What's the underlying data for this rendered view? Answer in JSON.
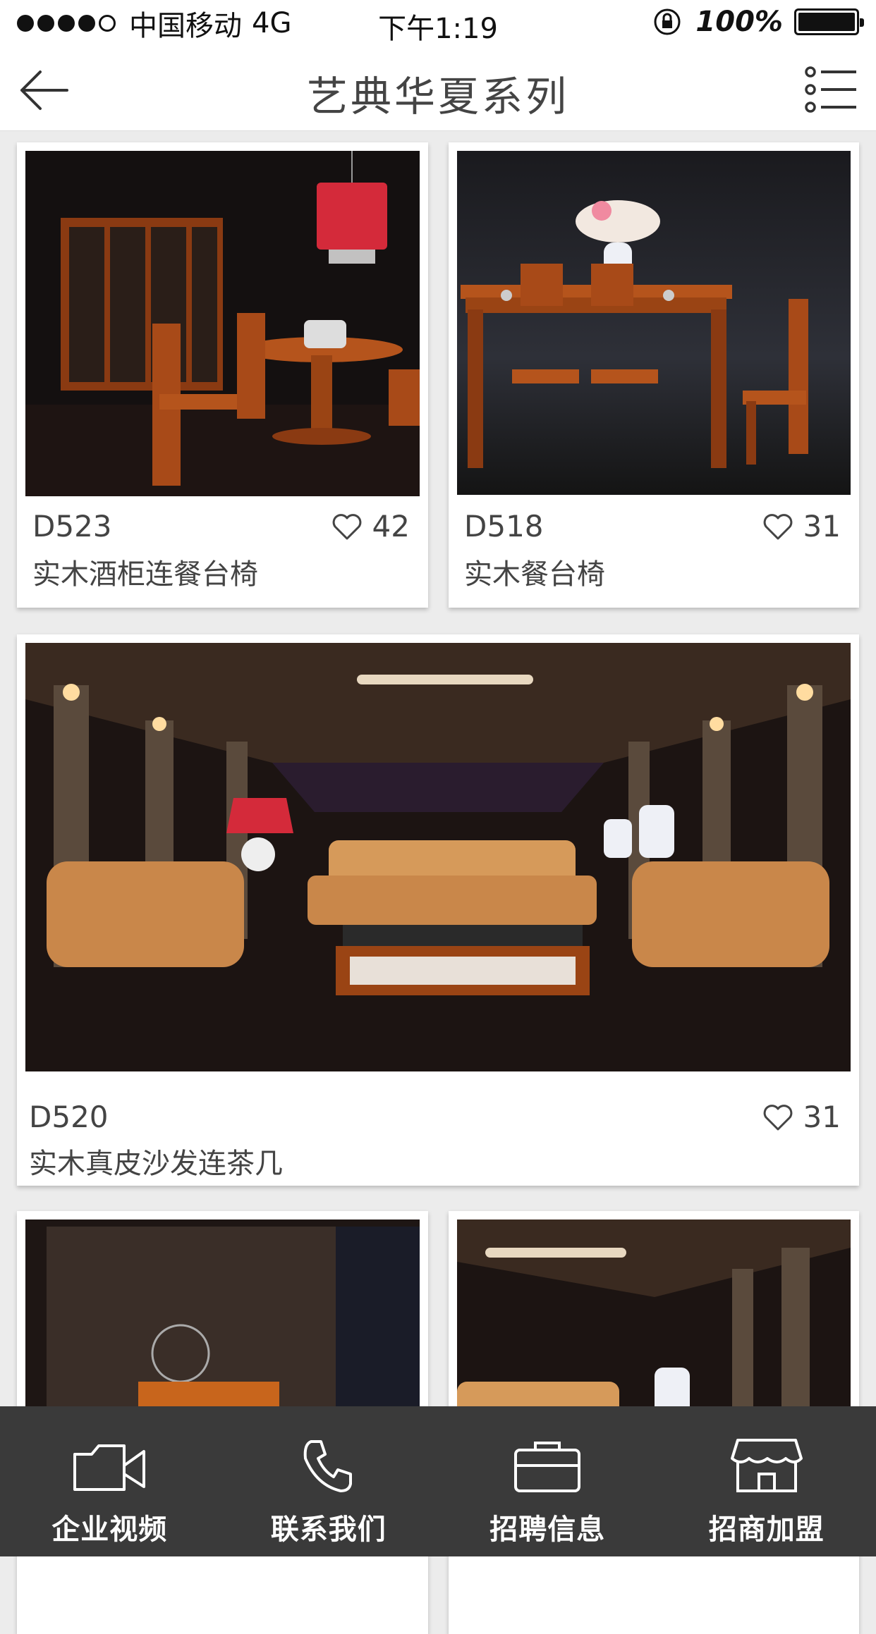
{
  "status_bar": {
    "carrier": "中国移动",
    "network": "4G",
    "time": "下午1:19",
    "battery_percent": "100%",
    "signal_bars_filled": 4,
    "signal_bars_total": 5
  },
  "header": {
    "title": "艺典华夏系列",
    "back_icon": "arrow-left-icon",
    "menu_icon": "list-menu-icon"
  },
  "products": [
    {
      "code": "D523",
      "name": "实木酒柜连餐台椅",
      "likes": "42",
      "image": "dining-room-wine-cabinet-round-table-photo"
    },
    {
      "code": "D518",
      "name": "实木餐台椅",
      "likes": "31",
      "image": "rectangular-dining-table-chairs-photo"
    },
    {
      "code": "D520",
      "name": "实木真皮沙发连茶几",
      "likes": "31",
      "image": "leather-sofa-set-with-tea-table-photo"
    },
    {
      "code": "",
      "name": "",
      "likes": "",
      "image": "tea-room-ink-painting-screen-photo"
    },
    {
      "code": "",
      "name": "",
      "likes": "",
      "image": "sofa-pavilion-chandelier-photo"
    }
  ],
  "tabs": [
    {
      "label": "企业视频",
      "icon": "video-camera-icon"
    },
    {
      "label": "联系我们",
      "icon": "phone-icon"
    },
    {
      "label": "招聘信息",
      "icon": "briefcase-icon"
    },
    {
      "label": "招商加盟",
      "icon": "storefront-icon"
    }
  ],
  "colors": {
    "page_bg": "#ececec",
    "tab_bar_bg": "#3a3a3a",
    "text": "#444444",
    "wood_accent": "#b5541c",
    "lamp_red": "#d42a3a"
  }
}
